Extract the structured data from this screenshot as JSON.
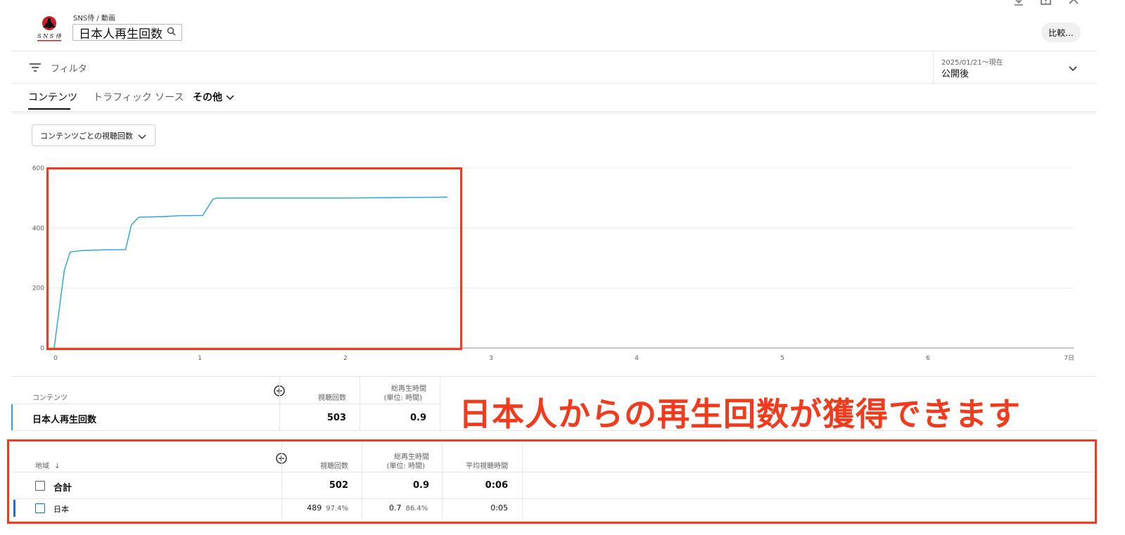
{
  "header": {
    "breadcrumb": "SNS侍 / 動画",
    "title": "日本人再生回数",
    "compare_label": "比較...",
    "icons": [
      "download-icon",
      "feedback-icon",
      "close-icon"
    ]
  },
  "filter": {
    "label": "フィルタ",
    "date_range": "2025/01/21～現在",
    "date_preset": "公開後"
  },
  "tabs": [
    {
      "label": "コンテンツ",
      "active": true
    },
    {
      "label": "トラフィック ソース",
      "active": false
    },
    {
      "label": "その他",
      "active": false
    }
  ],
  "metric_dropdown": "コンテンツごとの視聴回数",
  "chart_data": {
    "type": "line",
    "series": [
      {
        "color": "#2aa3d6",
        "x": [
          0,
          0.07,
          0.11,
          0.19,
          0.33,
          0.49,
          0.53,
          0.58,
          0.75,
          0.86,
          1.02,
          1.09,
          1.12,
          1.5,
          2.0,
          2.25,
          2.5,
          2.7
        ],
        "y": [
          0,
          260,
          320,
          325,
          327,
          328,
          410,
          436,
          438,
          441,
          442,
          496,
          500,
          500,
          500,
          501,
          502,
          503
        ]
      }
    ],
    "x_ticks": [
      "0",
      "1",
      "2",
      "3",
      "4",
      "5",
      "6",
      "7日"
    ],
    "xlim": [
      0,
      7
    ],
    "y_ticks": [
      "0",
      "200",
      "400",
      "600"
    ],
    "ylim": [
      0,
      600
    ],
    "grid": true
  },
  "content_table": {
    "headers": {
      "content": "コンテンツ",
      "views": "視聴回数",
      "watch_time_line1": "総再生時間",
      "watch_time_line2": "(単位: 時間)"
    },
    "row": {
      "name": "日本人再生回数",
      "views": "503",
      "watch_time": "0.9"
    }
  },
  "caption": "日本人からの再生回数が獲得できます",
  "region_table": {
    "headers": {
      "region": "地域",
      "views": "視聴回数",
      "watch_time_line1": "総再生時間",
      "watch_time_line2": "(単位: 時間)",
      "avg_duration": "平均視聴時間"
    },
    "total": {
      "label": "合計",
      "views": "502",
      "watch_time": "0.9",
      "avg_duration": "0:06"
    },
    "rows": [
      {
        "label": "日本",
        "views": "489",
        "views_pct": "97.4%",
        "watch_time": "0.7",
        "watch_time_pct": "86.4%",
        "avg_duration": "0:05"
      }
    ]
  },
  "colors": {
    "accent_red": "#f23a1c",
    "line_blue": "#2aa3d6",
    "row_marker_blue": "#1a6fd6"
  }
}
